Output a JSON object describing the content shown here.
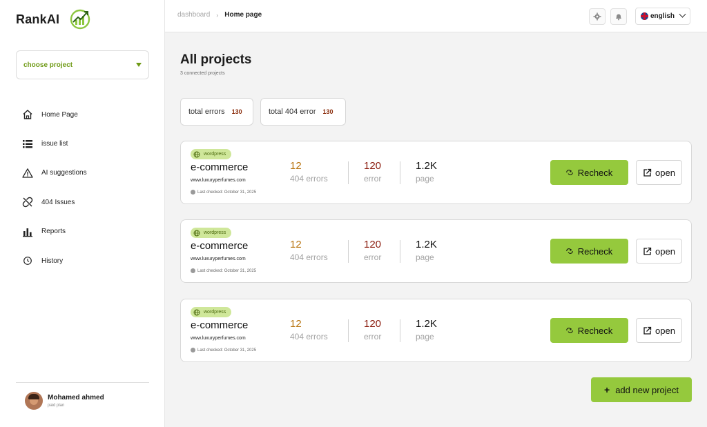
{
  "colors": {
    "accent_green": "#95c93d",
    "brand_green_text": "#6f9a16",
    "error_orange": "#b8740f",
    "error_red": "#8a1a0c",
    "chip_value": "#8a2c0b"
  },
  "sidebar": {
    "brand": "RankAI",
    "logo_icon": "trend-chart-logo-icon",
    "project_select": {
      "label": "choose project"
    },
    "nav": [
      {
        "label": "Home Page",
        "icon": "home-icon"
      },
      {
        "label": "issue list",
        "icon": "list-icon"
      },
      {
        "label": "AI suggestions",
        "icon": "warning-icon"
      },
      {
        "label": "404 Issues",
        "icon": "broken-link-icon"
      },
      {
        "label": "Reports",
        "icon": "bar-chart-icon"
      },
      {
        "label": "History",
        "icon": "clock-icon"
      }
    ],
    "profile": {
      "name": "Mohamed ahmed",
      "plan": "paid plan"
    }
  },
  "header": {
    "breadcrumb": {
      "parent": "dashboard",
      "current": "Home page"
    },
    "language": "english"
  },
  "main": {
    "title": "All projects",
    "subtitle": "3 connected projects",
    "stats": [
      {
        "label": "total errors",
        "value": "130"
      },
      {
        "label": "total 404 error",
        "value": "130"
      }
    ],
    "projects": [
      {
        "tag": "wordpress",
        "name": "e-commerce",
        "url": "www.luxuryperfumes.com",
        "last_checked": "Last checked: October 31, 2025",
        "metrics": [
          {
            "value": "12",
            "label": "404 errors"
          },
          {
            "value": "120",
            "label": "error"
          },
          {
            "value": "1.2K",
            "label": "page"
          }
        ],
        "recheck_label": "Recheck",
        "open_label": "open"
      },
      {
        "tag": "wordpress",
        "name": "e-commerce",
        "url": "www.luxuryperfumes.com",
        "last_checked": "Last checked: October 31, 2025",
        "metrics": [
          {
            "value": "12",
            "label": "404 errors"
          },
          {
            "value": "120",
            "label": "error"
          },
          {
            "value": "1.2K",
            "label": "page"
          }
        ],
        "recheck_label": "Recheck",
        "open_label": "open"
      },
      {
        "tag": "wordpress",
        "name": "e-commerce",
        "url": "www.luxuryperfumes.com",
        "last_checked": "Last checked: October 31, 2025",
        "metrics": [
          {
            "value": "12",
            "label": "404 errors"
          },
          {
            "value": "120",
            "label": "error"
          },
          {
            "value": "1.2K",
            "label": "page"
          }
        ],
        "recheck_label": "Recheck",
        "open_label": "open"
      }
    ],
    "add_project_label": "add new project"
  }
}
